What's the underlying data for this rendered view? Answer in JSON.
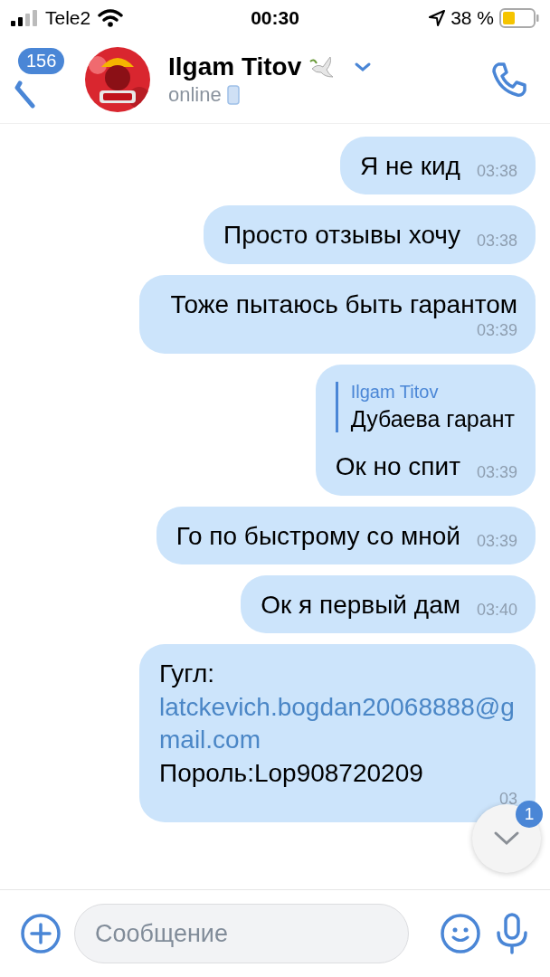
{
  "status_bar": {
    "carrier": "Tele2",
    "time": "00:30",
    "battery": "38 %"
  },
  "header": {
    "back_badge": "156",
    "name": "Ilgam Titov",
    "status": "online"
  },
  "messages": [
    {
      "parts": [
        {
          "kind": "text",
          "text": "Я не кид"
        }
      ],
      "time": "03:38"
    },
    {
      "parts": [
        {
          "kind": "text",
          "text": "Просто отзывы хочу"
        }
      ],
      "time": "03:38"
    },
    {
      "parts": [
        {
          "kind": "text",
          "text": "Тоже пытаюсь быть гарантом"
        }
      ],
      "time": "03:39"
    },
    {
      "reply": {
        "author": "Ilgam Titov",
        "text": "Дубаева гарант"
      },
      "parts": [
        {
          "kind": "text",
          "text": "Ок но спит"
        }
      ],
      "time": "03:39"
    },
    {
      "parts": [
        {
          "kind": "text",
          "text": "Го по быстрому со мной"
        }
      ],
      "time": "03:39"
    },
    {
      "parts": [
        {
          "kind": "text",
          "text": "Ок я первый дам"
        }
      ],
      "time": "03:40"
    },
    {
      "parts": [
        {
          "kind": "text",
          "text": "Гугл:"
        },
        {
          "kind": "link",
          "text": "latckevich.bogdan20068888@gmail.com"
        },
        {
          "kind": "text",
          "text": "Пороль:Lop908720209"
        }
      ],
      "time": "03"
    }
  ],
  "scroll_button": {
    "badge": "1"
  },
  "composer": {
    "placeholder": "Сообщение"
  }
}
